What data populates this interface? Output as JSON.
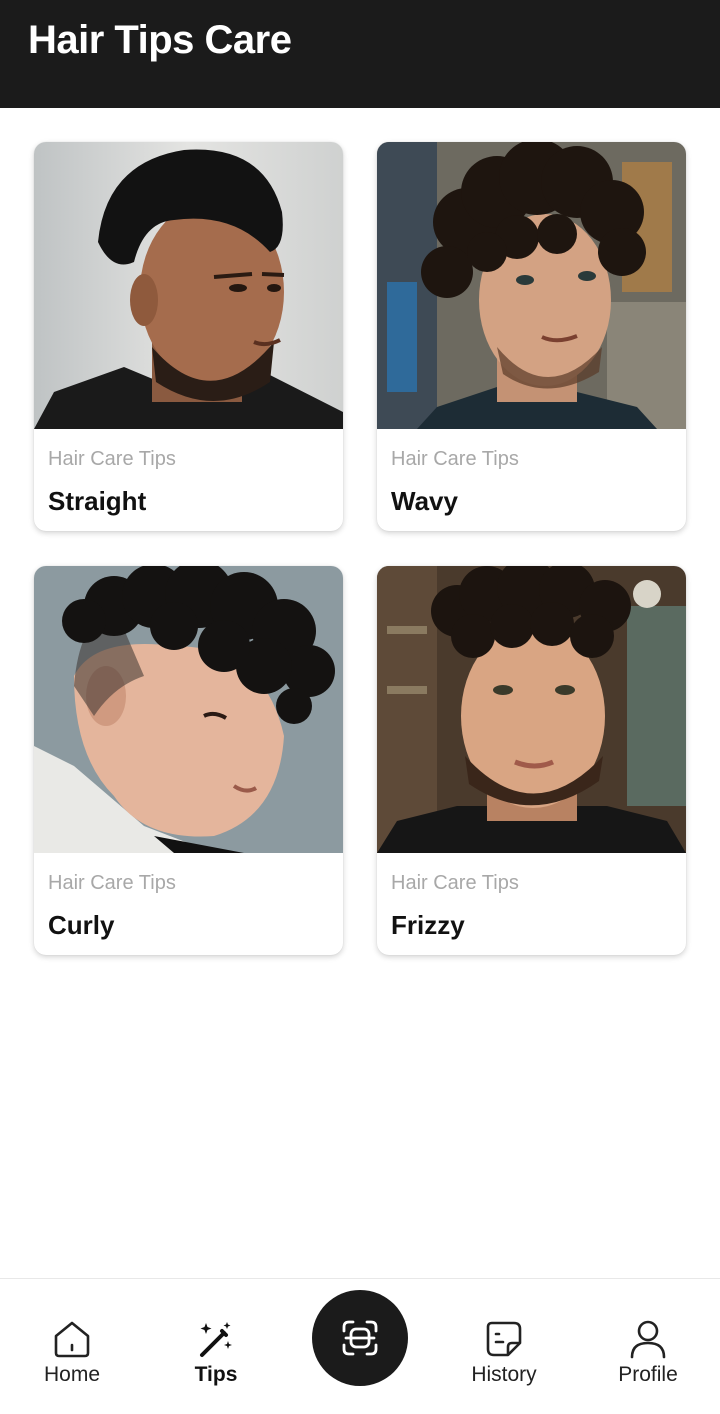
{
  "header": {
    "title": "Hair Tips Care"
  },
  "cards": [
    {
      "subtitle": "Hair Care Tips",
      "title": "Straight"
    },
    {
      "subtitle": "Hair Care Tips",
      "title": "Wavy"
    },
    {
      "subtitle": "Hair Care Tips",
      "title": "Curly"
    },
    {
      "subtitle": "Hair Care Tips",
      "title": "Frizzy"
    }
  ],
  "nav": {
    "items": [
      {
        "label": "Home",
        "icon": "home-icon"
      },
      {
        "label": "Tips",
        "icon": "magic-wand-icon",
        "active": true
      },
      {
        "label": "History",
        "icon": "document-icon"
      },
      {
        "label": "Profile",
        "icon": "user-icon"
      }
    ],
    "center_icon": "scan-face-icon"
  },
  "colors": {
    "header_bg": "#1b1b1b",
    "subtitle": "#a8a8a8",
    "title": "#111111"
  }
}
